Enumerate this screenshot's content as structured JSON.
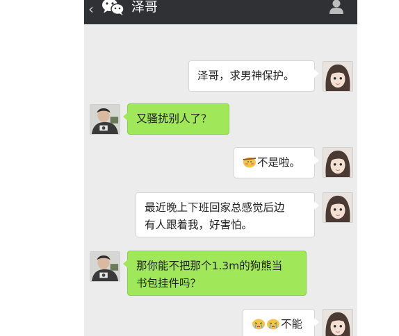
{
  "header": {
    "title": "泽哥"
  },
  "icons": {
    "back": "chevron-left-icon",
    "logo": "wechat-logo-icon",
    "profile": "person-icon"
  },
  "colors": {
    "topbar": "#2f3135",
    "chat_background": "#ececec",
    "sent_bubble": "#ffffff",
    "received_bubble": "#a0e75a"
  },
  "messages": [
    {
      "side": "right",
      "text": "泽哥，求男神保护。"
    },
    {
      "side": "left",
      "text": "又骚扰别人了？"
    },
    {
      "side": "right",
      "emoji": "blushing-face-emoji",
      "text": "不是啦。"
    },
    {
      "side": "right",
      "line1": "最近晚上下班回家总感觉后边",
      "line2": "有人跟着我，好害怕。"
    },
    {
      "side": "left",
      "line1": "那你能不把那个1.3m的狗熊当",
      "line2": "书包挂件吗？"
    },
    {
      "side": "right",
      "emoji": "crying-face-emoji",
      "text": "不能"
    }
  ]
}
